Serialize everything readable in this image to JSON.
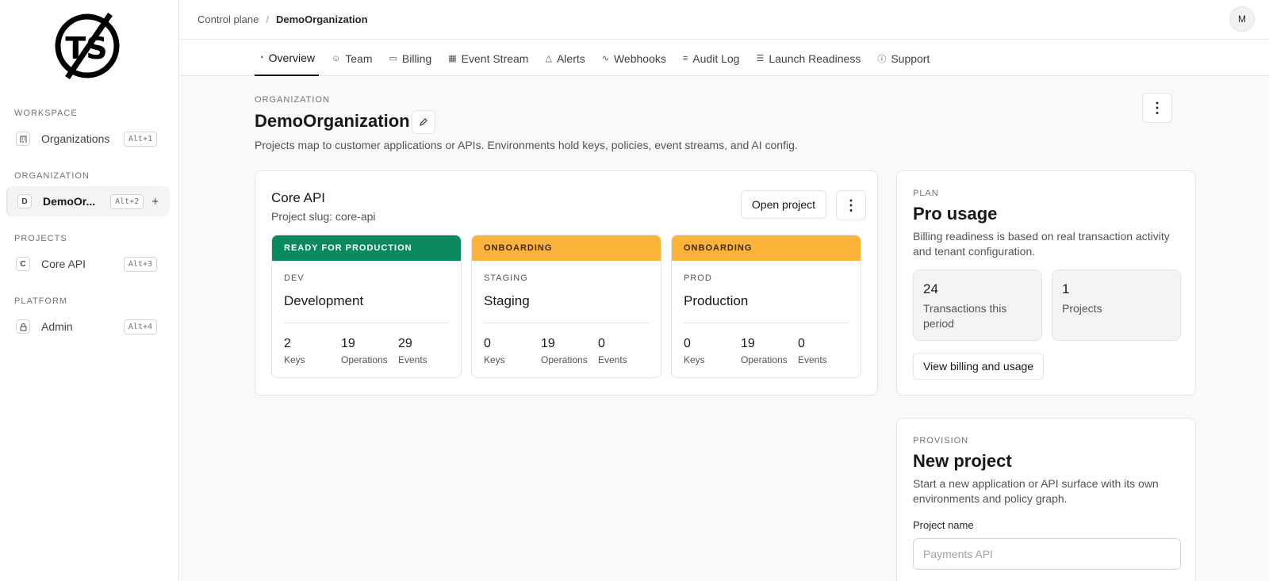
{
  "sidebar": {
    "logo_text": "TS",
    "sections": [
      {
        "label": "WORKSPACE"
      },
      {
        "label": "ORGANIZATION"
      },
      {
        "label": "PROJECTS"
      },
      {
        "label": "PLATFORM"
      }
    ],
    "items": [
      {
        "label": "Organizations",
        "shortcut": "Alt+1",
        "icon": "building-icon"
      },
      {
        "label": "DemoOr...",
        "shortcut": "Alt+2",
        "badge": "D",
        "add": "+"
      },
      {
        "label": "Core API",
        "shortcut": "Alt+3",
        "badge": "C"
      },
      {
        "label": "Admin",
        "shortcut": "Alt+4",
        "icon": "lock-icon"
      }
    ]
  },
  "header": {
    "breadcrumb": [
      "Control plane",
      "DemoOrganization"
    ],
    "separator": "/",
    "avatar": "M"
  },
  "tabs": [
    {
      "label": "Overview",
      "icon": "gauge-icon",
      "active": true
    },
    {
      "label": "Team",
      "icon": "users-icon"
    },
    {
      "label": "Billing",
      "icon": "card-icon"
    },
    {
      "label": "Event Stream",
      "icon": "calendar-icon"
    },
    {
      "label": "Alerts",
      "icon": "warning-icon"
    },
    {
      "label": "Webhooks",
      "icon": "webhook-icon"
    },
    {
      "label": "Audit Log",
      "icon": "log-icon"
    },
    {
      "label": "Launch Readiness",
      "icon": "checklist-icon"
    },
    {
      "label": "Support",
      "icon": "help-icon"
    }
  ],
  "org": {
    "eyebrow": "ORGANIZATION",
    "title": "DemoOrganization",
    "description": "Projects map to customer applications or APIs. Environments hold keys, policies, event streams, and AI config."
  },
  "project": {
    "title": "Core API",
    "slug": "Project slug: core-api",
    "open_label": "Open project",
    "environments": [
      {
        "status": "READY FOR PRODUCTION",
        "status_color": "#0a8a5c",
        "key": "DEV",
        "name": "Development",
        "stats": [
          {
            "value": "2",
            "label": "Keys"
          },
          {
            "value": "19",
            "label": "Operations"
          },
          {
            "value": "29",
            "label": "Events"
          }
        ]
      },
      {
        "status": "ONBOARDING",
        "status_color": "#fbb33a",
        "key": "STAGING",
        "name": "Staging",
        "stats": [
          {
            "value": "0",
            "label": "Keys"
          },
          {
            "value": "19",
            "label": "Operations"
          },
          {
            "value": "0",
            "label": "Events"
          }
        ]
      },
      {
        "status": "ONBOARDING",
        "status_color": "#fbb33a",
        "key": "PROD",
        "name": "Production",
        "stats": [
          {
            "value": "0",
            "label": "Keys"
          },
          {
            "value": "19",
            "label": "Operations"
          },
          {
            "value": "0",
            "label": "Events"
          }
        ]
      }
    ]
  },
  "plan": {
    "eyebrow": "PLAN",
    "title": "Pro usage",
    "description": "Billing readiness is based on real transaction activity and tenant configuration.",
    "metrics": [
      {
        "value": "24",
        "label": "Transactions this period"
      },
      {
        "value": "1",
        "label": "Projects"
      }
    ],
    "button_label": "View billing and usage"
  },
  "provision": {
    "eyebrow": "PROVISION",
    "title": "New project",
    "description": "Start a new application or API surface with its own environments and policy graph.",
    "field_label": "Project name",
    "field_value": "",
    "field_placeholder": "Payments API"
  },
  "colors": {
    "accent_green": "#0a8a5c",
    "accent_amber": "#fbb33a",
    "background": "#faf8f8"
  }
}
